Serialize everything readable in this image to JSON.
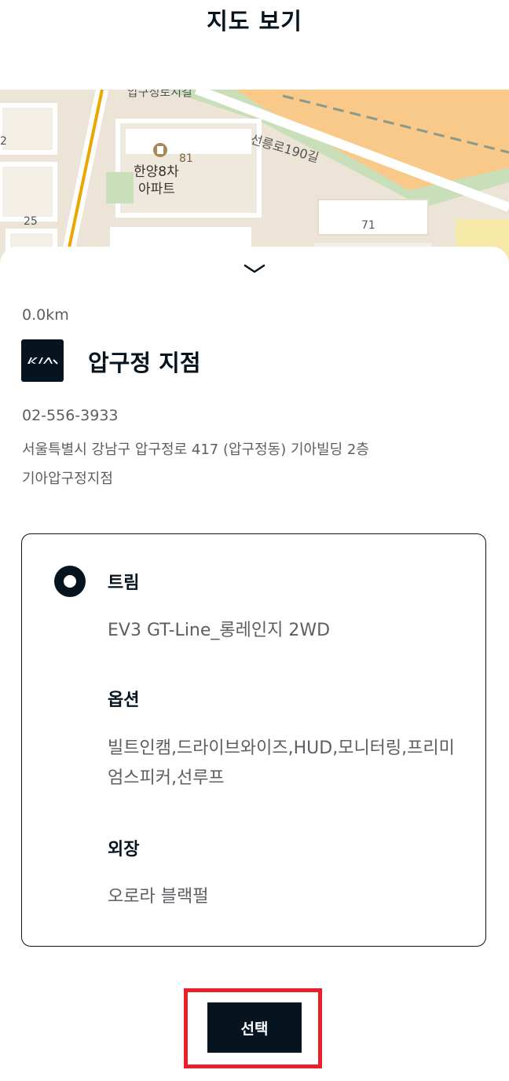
{
  "header": {
    "title": "지도 보기"
  },
  "map": {
    "labels": {
      "top_street": "압구정로지길",
      "road_name": "선릉로190길",
      "apartment_line1": "한양8차",
      "apartment_line2": "아파트",
      "number_81": "81",
      "number_25": "25",
      "number_71": "71",
      "number_2": "2"
    },
    "icons": {
      "apartment": "building-icon"
    },
    "colors": {
      "land": "#ece4d6",
      "green": "#c9dfb9",
      "road_major": "#f9c98a",
      "road_line": "#e9a700",
      "building": "#ffffff"
    }
  },
  "sheet": {
    "collapse_icon": "chevron-down-icon",
    "distance": "0.0km",
    "brand_logo": "kia-logo",
    "branch_name": "압구정 지점",
    "phone": "02-556-3933",
    "address": "서울특별시 강남구 압구정로 417 (압구정동) 기아빌딩 2층",
    "dealer": "기아압구정지점"
  },
  "option_card": {
    "selected": true,
    "trim_label": "트림",
    "trim_value": "EV3 GT-Line_롱레인지 2WD",
    "options_label": "옵션",
    "options_value": "빌트인캠,드라이브와이즈,HUD,모니터링,프리미엄스피커,선루프",
    "exterior_label": "외장",
    "exterior_value": "오로라 블랙펄"
  },
  "actions": {
    "select_label": "선택",
    "highlight_color": "#e8202a"
  },
  "colors": {
    "primary": "#05141f",
    "text_secondary": "#5b5f63"
  }
}
